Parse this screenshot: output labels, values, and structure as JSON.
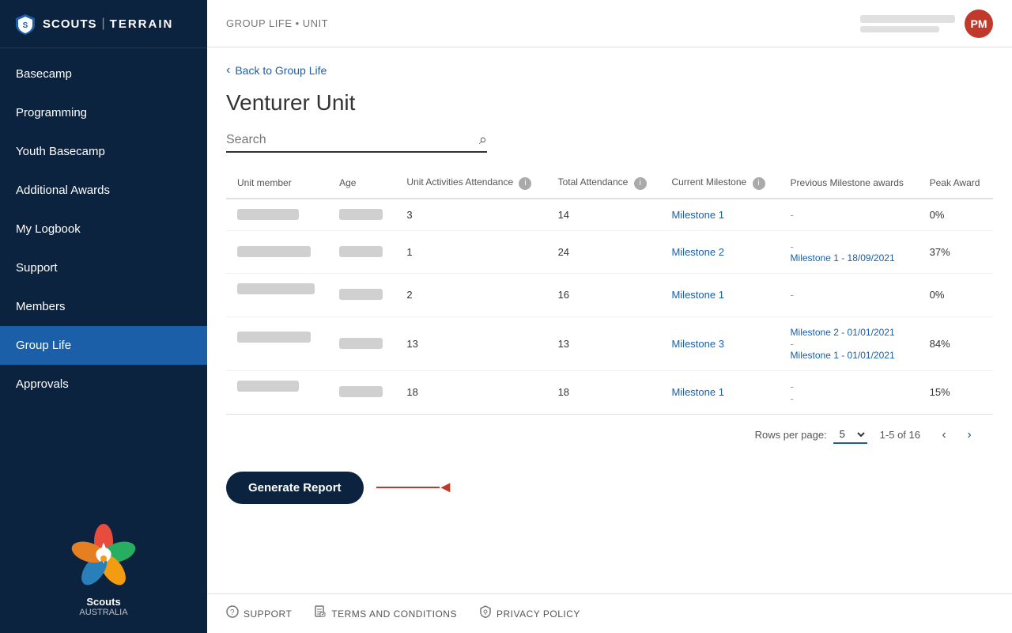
{
  "sidebar": {
    "logo": {
      "brand": "SCOUTS",
      "separator": "|",
      "product": "TERRAIN"
    },
    "nav_items": [
      {
        "id": "basecamp",
        "label": "Basecamp",
        "active": false
      },
      {
        "id": "programming",
        "label": "Programming",
        "active": false
      },
      {
        "id": "youth-basecamp",
        "label": "Youth Basecamp",
        "active": false
      },
      {
        "id": "additional-awards",
        "label": "Additional Awards",
        "active": false
      },
      {
        "id": "my-logbook",
        "label": "My Logbook",
        "active": false
      },
      {
        "id": "support",
        "label": "Support",
        "active": false
      },
      {
        "id": "members",
        "label": "Members",
        "active": false
      },
      {
        "id": "group-life",
        "label": "Group Life",
        "active": true
      },
      {
        "id": "approvals",
        "label": "Approvals",
        "active": false
      }
    ],
    "scouts_label": "Scouts",
    "scouts_sublabel": "AUSTRALIA"
  },
  "topbar": {
    "breadcrumb": "GROUP LIFE • UNIT",
    "user_avatar": "PM"
  },
  "back_link": "Back to Group Life",
  "page_title": "Venturer Unit",
  "search": {
    "placeholder": "Search",
    "value": ""
  },
  "table": {
    "columns": [
      {
        "id": "member",
        "label": "Unit member"
      },
      {
        "id": "age",
        "label": "Age"
      },
      {
        "id": "unit-activities",
        "label": "Unit Activities Attendance",
        "info": true
      },
      {
        "id": "total-attendance",
        "label": "Total Attendance",
        "info": true
      },
      {
        "id": "current-milestone",
        "label": "Current Milestone",
        "info": true
      },
      {
        "id": "previous-milestone",
        "label": "Previous Milestone awards"
      },
      {
        "id": "peak-award",
        "label": "Peak Award"
      }
    ],
    "rows": [
      {
        "member": "████████████",
        "age": "██, ███",
        "unit_activities": "3",
        "total_attendance": "14",
        "current_milestone": "Milestone 1",
        "previous_milestones": [
          "-"
        ],
        "peak_award": "0%"
      },
      {
        "member": "████████",
        "age": "██, ███",
        "unit_activities": "1",
        "total_attendance": "24",
        "current_milestone": "Milestone 2",
        "previous_milestones": [
          "-",
          "Milestone 1 - 18/09/2021"
        ],
        "peak_award": "37%"
      },
      {
        "member": "████ ████████",
        "age": "██, ███",
        "unit_activities": "2",
        "total_attendance": "16",
        "current_milestone": "Milestone 1",
        "previous_milestones": [
          "-"
        ],
        "peak_award": "0%"
      },
      {
        "member": "█████████ ████████",
        "age": "██, ███",
        "unit_activities": "13",
        "total_attendance": "13",
        "current_milestone": "Milestone 3",
        "previous_milestones": [
          "Milestone 2 - 01/01/2021",
          "-",
          "Milestone 1 - 01/01/2021"
        ],
        "peak_award": "84%"
      },
      {
        "member": "███████ ██████",
        "age": "██, ███",
        "unit_activities": "18",
        "total_attendance": "18",
        "current_milestone": "Milestone 1",
        "previous_milestones": [
          "-",
          "-"
        ],
        "peak_award": "15%"
      }
    ],
    "pagination": {
      "rows_per_page_label": "Rows per page:",
      "rows_per_page_value": "5",
      "page_info": "1-5 of 16",
      "prev_disabled": true,
      "next_disabled": false
    }
  },
  "generate_report_btn": "Generate Report",
  "footer": {
    "links": [
      {
        "id": "support",
        "label": "SUPPORT",
        "icon": "?"
      },
      {
        "id": "terms",
        "label": "TERMS AND CONDITIONS",
        "icon": "📄"
      },
      {
        "id": "privacy",
        "label": "PRIVACY POLICY",
        "icon": "🔒"
      }
    ]
  }
}
